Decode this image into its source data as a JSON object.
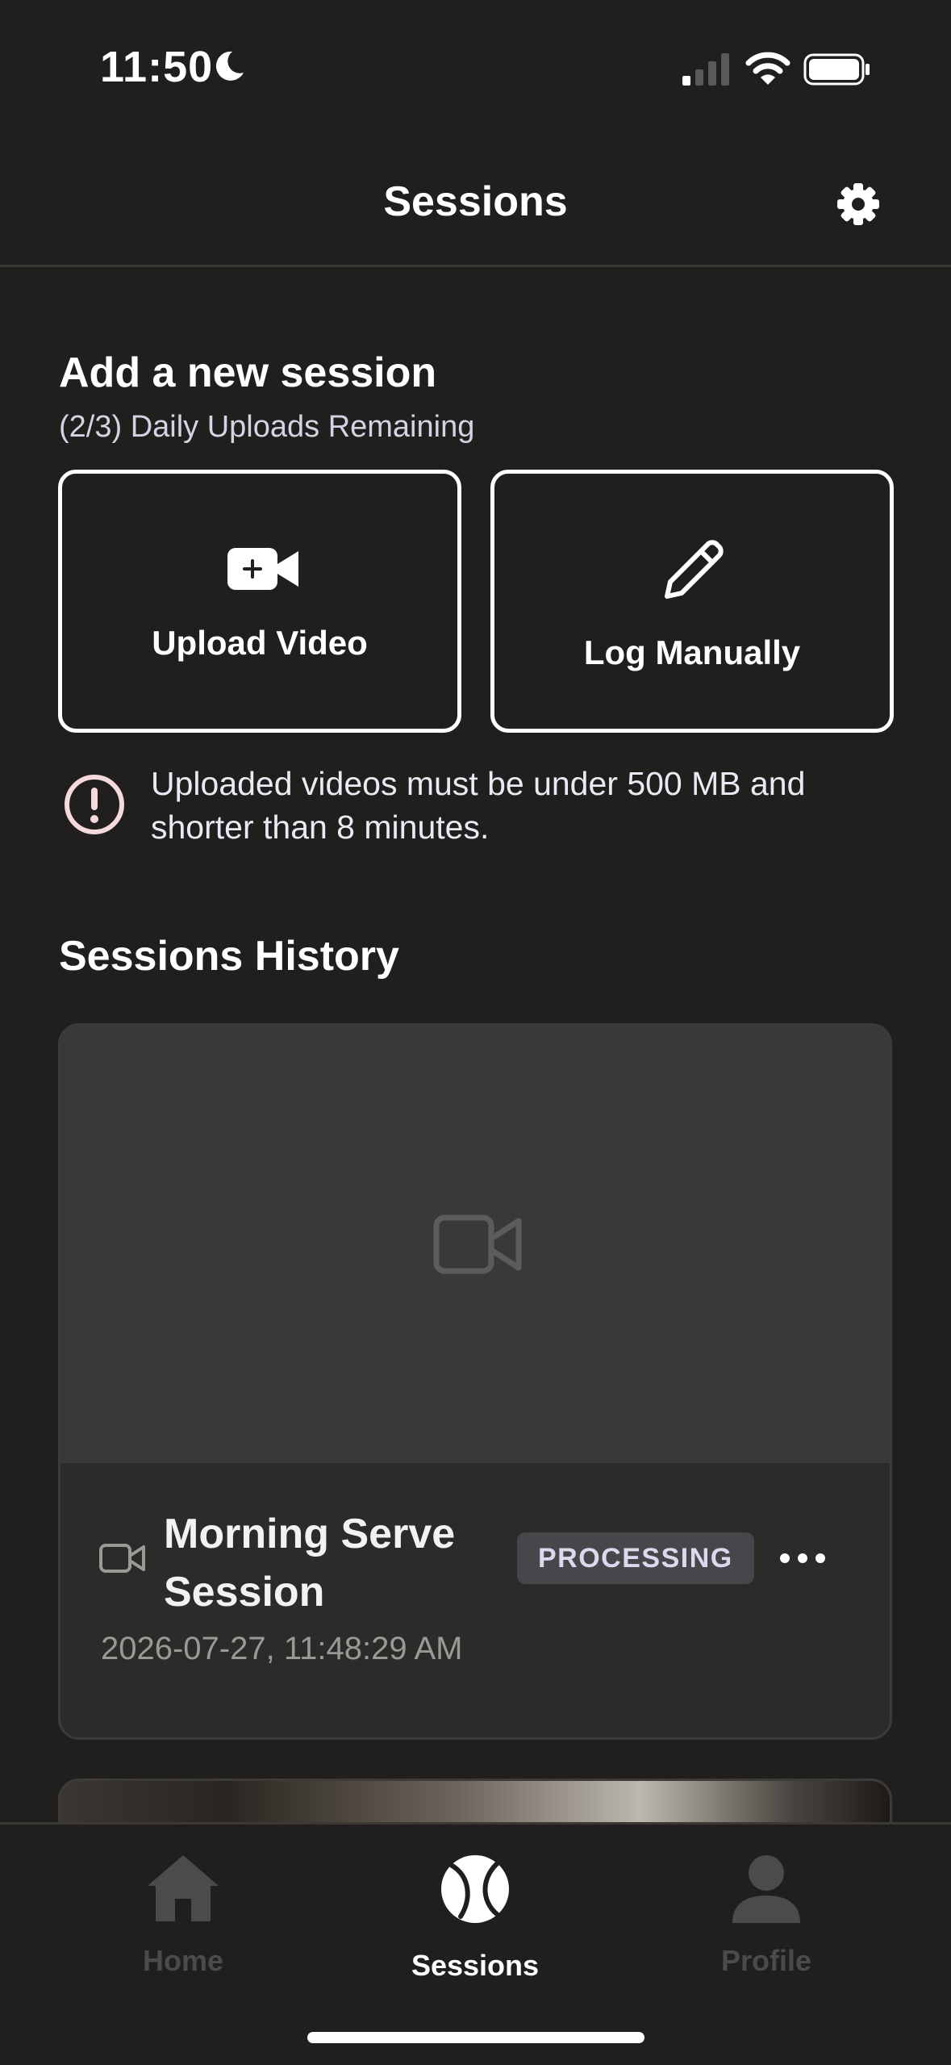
{
  "status_bar": {
    "time": "11:50"
  },
  "header": {
    "title": "Sessions"
  },
  "add_session": {
    "title": "Add a new session",
    "subtitle": "(2/3) Daily Uploads Remaining",
    "upload_label": "Upload Video",
    "log_label": "Log Manually",
    "notice": "Uploaded videos must be under 500 MB and shorter than 8 minutes."
  },
  "history": {
    "title": "Sessions History",
    "sessions": [
      {
        "title": "Morning Serve Session",
        "date": "2026-07-27, 11:48:29 AM",
        "status": "PROCESSING"
      }
    ]
  },
  "tabs": [
    {
      "label": "Home"
    },
    {
      "label": "Sessions"
    },
    {
      "label": "Profile"
    }
  ],
  "colors": {
    "background": "#201f1d",
    "card": "#2c2b29",
    "badge": "#47464a",
    "warning": "#f6d9df"
  }
}
